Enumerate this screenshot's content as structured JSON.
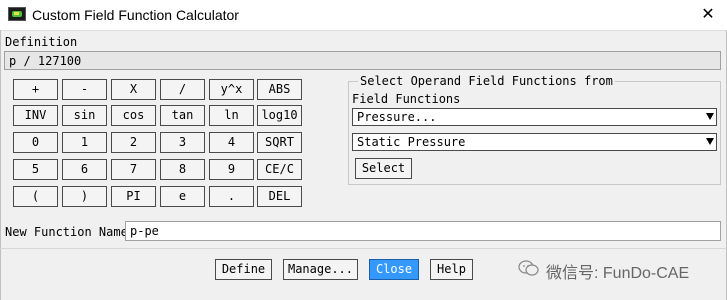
{
  "window": {
    "title": "Custom Field Function Calculator",
    "close_glyph": "✕"
  },
  "definition": {
    "label": "Definition",
    "value": "p / 127100"
  },
  "keypad": {
    "rows": [
      [
        "+",
        "-",
        "X",
        "/",
        "y^x",
        "ABS"
      ],
      [
        "INV",
        "sin",
        "cos",
        "tan",
        "ln",
        "log10"
      ],
      [
        "0",
        "1",
        "2",
        "3",
        "4",
        "SQRT"
      ],
      [
        "5",
        "6",
        "7",
        "8",
        "9",
        "CE/C"
      ],
      [
        "(",
        ")",
        "PI",
        "e",
        ".",
        "DEL"
      ]
    ]
  },
  "operand": {
    "legend": "Select Operand Field Functions from",
    "field_functions_label": "Field Functions",
    "category_value": "Pressure...",
    "function_value": "Static Pressure",
    "select_label": "Select"
  },
  "new_function": {
    "label": "New Function Name",
    "value": "p-pe"
  },
  "buttons": {
    "define": "Define",
    "manage": "Manage...",
    "close": "Close",
    "help": "Help"
  },
  "watermark": {
    "text": "微信号: FunDo-CAE"
  },
  "colors": {
    "primary_button": "#3399ff",
    "icon_green": "#4fbf3c"
  }
}
